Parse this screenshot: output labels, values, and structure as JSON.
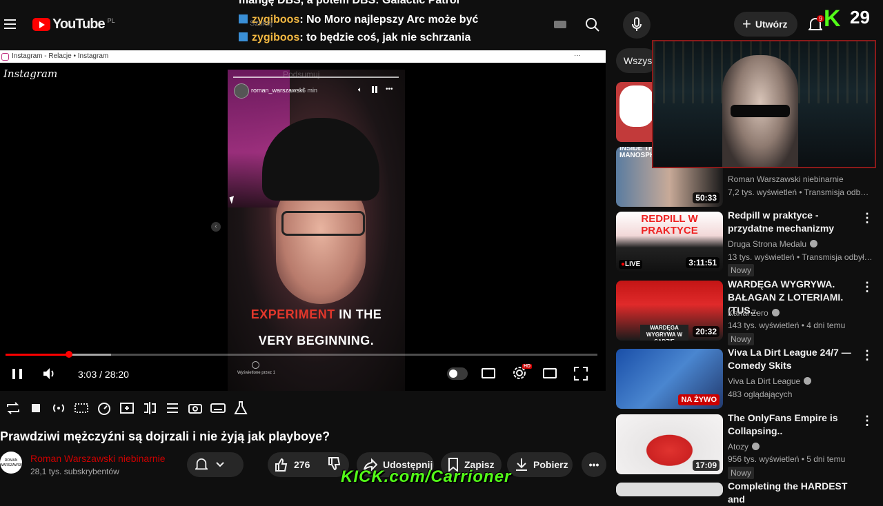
{
  "header": {
    "logo_text": "YouTube",
    "logo_region": "PL",
    "search_placeholder": "Szukaj",
    "create_label": "Utwórz",
    "notification_count": "9",
    "overlay_counter": "29",
    "overlay_k": "K"
  },
  "chat": {
    "top_line": "mangę DBS, a potem DBS: Galactic Patrol",
    "messages": [
      {
        "user": "zygiboos",
        "text": ": No Moro najlepszy Arc może być"
      },
      {
        "user": "zygiboos",
        "text": ": to będzie coś, jak nie schrzania"
      }
    ]
  },
  "browser": {
    "tab_title": "Instagram - Relacje • Instagram",
    "dots": "···"
  },
  "story": {
    "brand": "Instagram",
    "ghost_label": "Podsumuj",
    "username": "roman_warszawski",
    "time": "6 min",
    "more": "•••",
    "caption_red": "EXPERIMENT",
    "caption_rest": " IN THE",
    "caption_line2": "VERY BEGINNING.",
    "viewed_by": "Wyświetlone przez 1"
  },
  "player": {
    "time_display": "3:03 / 28:20",
    "progress": 0.107,
    "buffered": 0.178,
    "settings_badge": "HD"
  },
  "video": {
    "title": "Prawdziwi mężczyźni są dojrzali i nie żyją jak playboye?",
    "channel": "Roman Warszawski niebinarnie",
    "subscribers": "28,1 tys. subskrybentów",
    "avatar_text": "ROMAN WARSZAWSKI",
    "likes": "276",
    "share_label": "Udostępnij",
    "save_label": "Zapisz",
    "download_label": "Pobierz"
  },
  "sidebar": {
    "filter_label": "Wszyst",
    "recs": [
      {
        "title": "",
        "channel": "",
        "meta": "",
        "badge": "",
        "duration": ""
      },
      {
        "title": "",
        "channel": "Roman Warszawski niebinarnie",
        "meta": "7,2 tys. wyświetleń • Transmisja odbyła s...",
        "badge": "",
        "duration": "50:33",
        "thumb_text": "INSIDE TH MANOSPH"
      },
      {
        "title": "Redpill w praktyce - przydatne mechanizmy",
        "channel": "Druga Strona Medalu",
        "meta": "13 tys. wyświetleń • Transmisja odbyła s...",
        "badge": "Nowy",
        "duration": "3:11:51",
        "live_tag": "LIVE",
        "thumb_text": "REDPILL W PRAKTYCE"
      },
      {
        "title": "WARDĘGA WYGRYWA. BAŁAGAN Z LOTERIAMI. (TUS...",
        "channel": "Kanał Zero",
        "meta": "143 tys. wyświetleń • 4 dni temu",
        "badge": "Nowy",
        "duration": "20:32",
        "thumb_text": "WARDĘGA WYGRYWA W SĄDZIE"
      },
      {
        "title": "Viva La Dirt League 24/7 — Comedy Skits",
        "channel": "Viva La Dirt League",
        "meta": "483 oglądających",
        "badge": "",
        "live_label": "NA ŻYWO"
      },
      {
        "title": "The OnlyFans Empire is Collapsing..",
        "channel": "Atozy",
        "meta": "956 tys. wyświetleń • 5 dni temu",
        "badge": "Nowy",
        "duration": "17:09"
      },
      {
        "title": "Completing the HARDEST and",
        "channel": "",
        "meta": "",
        "badge": "",
        "duration": ""
      }
    ]
  },
  "overlay": {
    "kick_text": "KICK.com/Carrioner"
  },
  "colors": {
    "bg": "#0f0f0f",
    "accent_red": "#ff0000",
    "kick_green": "#53fc18",
    "chat_user": "#f4b942"
  }
}
